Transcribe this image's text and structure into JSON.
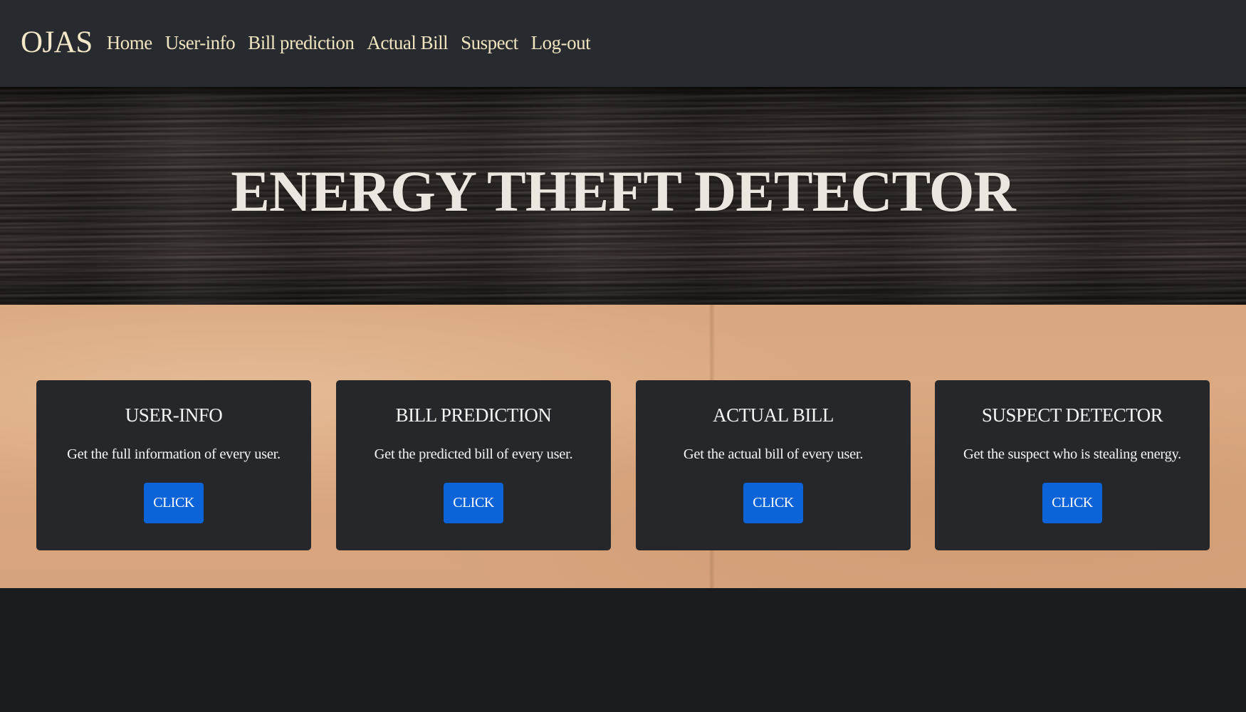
{
  "navbar": {
    "brand": "OJAS",
    "links": [
      "Home",
      "User-info",
      "Bill prediction",
      "Actual Bill",
      "Suspect",
      "Log-out"
    ]
  },
  "hero": {
    "title": "ENERGY THEFT DETECTOR"
  },
  "cards": [
    {
      "title": "USER-INFO",
      "text": "Get the full information of every user.",
      "button": "CLICK"
    },
    {
      "title": "BILL PREDICTION",
      "text": "Get the predicted bill of every user.",
      "button": "CLICK"
    },
    {
      "title": "ACTUAL BILL",
      "text": "Get the actual bill of every user.",
      "button": "CLICK"
    },
    {
      "title": "SUSPECT DETECTOR",
      "text": "Get the suspect who is stealing energy.",
      "button": "CLICK"
    }
  ],
  "colors": {
    "navbar_bg": "#272a2e",
    "nav_text": "#f0e4bf",
    "card_bg": "#25272b",
    "button_bg": "#0d63d8",
    "paper_bg": "#d9a880",
    "footer_bg": "#1b1c1f"
  }
}
